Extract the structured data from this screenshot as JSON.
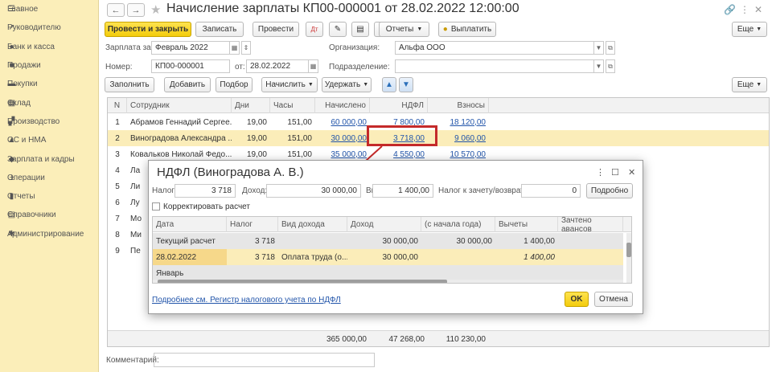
{
  "sidebar": {
    "items": [
      {
        "icon": "menu-icon",
        "label": "Главное"
      },
      {
        "icon": "trend-icon",
        "label": "Руководителю"
      },
      {
        "icon": "bank-icon",
        "label": "Банк и касса"
      },
      {
        "icon": "cart-icon",
        "label": "Продажи"
      },
      {
        "icon": "basket-icon",
        "label": "Покупки"
      },
      {
        "icon": "warehouse-icon",
        "label": "Склад"
      },
      {
        "icon": "factory-icon",
        "label": "Производство"
      },
      {
        "icon": "assets-icon",
        "label": "ОС и НМА"
      },
      {
        "icon": "people-icon",
        "label": "Зарплата и кадры"
      },
      {
        "icon": "operations-icon",
        "label": "Операции"
      },
      {
        "icon": "reports-icon",
        "label": "Отчеты"
      },
      {
        "icon": "book-icon",
        "label": "Справочники"
      },
      {
        "icon": "gear-icon",
        "label": "Администрирование"
      }
    ]
  },
  "header": {
    "title": "Начисление зарплаты КП00-000001 от 28.02.2022 12:00:00",
    "back": "←",
    "forward": "→",
    "star": "★"
  },
  "toolbar": {
    "post_close": "Провести и закрыть",
    "save": "Записать",
    "post": "Провести",
    "reports": "Отчеты",
    "pay": "Выплатить",
    "more": "Еще"
  },
  "form": {
    "salary_for_label": "Зарплата за:",
    "salary_for_value": "Февраль 2022",
    "org_label": "Организация:",
    "org_value": "Альфа ООО",
    "number_label": "Номер:",
    "number_value": "КП00-000001",
    "date_label": "от:",
    "date_value": "28.02.2022",
    "dept_label": "Подразделение:",
    "dept_value": ""
  },
  "table_toolbar": {
    "fill": "Заполнить",
    "add": "Добавить",
    "select": "Подбор",
    "accrue": "Начислить",
    "withhold": "Удержать",
    "more": "Еще"
  },
  "table": {
    "columns": [
      "N",
      "Сотрудник",
      "Дни",
      "Часы",
      "Начислено",
      "НДФЛ",
      "Взносы"
    ],
    "rows": [
      {
        "n": "1",
        "emp": "Абрамов Геннадий Сергее...",
        "days": "19,00",
        "hours": "151,00",
        "accrued": "60 000,00",
        "ndfl": "7 800,00",
        "contrib": "18 120,00"
      },
      {
        "n": "2",
        "emp": "Виноградова Александра ...",
        "days": "19,00",
        "hours": "151,00",
        "accrued": "30 000,00",
        "ndfl": "3 718,00",
        "contrib": "9 060,00"
      },
      {
        "n": "3",
        "emp": "Ковальков Николай Федо...",
        "days": "19,00",
        "hours": "151,00",
        "accrued": "35 000,00",
        "ndfl": "4 550,00",
        "contrib": "10 570,00"
      },
      {
        "n": "4",
        "emp": "Ла",
        "days": "",
        "hours": "",
        "accrued": "",
        "ndfl": "",
        "contrib": ""
      },
      {
        "n": "5",
        "emp": "Ли",
        "days": "",
        "hours": "",
        "accrued": "",
        "ndfl": "",
        "contrib": ""
      },
      {
        "n": "6",
        "emp": "Лу",
        "days": "",
        "hours": "",
        "accrued": "",
        "ndfl": "",
        "contrib": ""
      },
      {
        "n": "7",
        "emp": "Мо",
        "days": "",
        "hours": "",
        "accrued": "",
        "ndfl": "",
        "contrib": ""
      },
      {
        "n": "8",
        "emp": "Ми",
        "days": "",
        "hours": "",
        "accrued": "",
        "ndfl": "",
        "contrib": ""
      },
      {
        "n": "9",
        "emp": "Пе",
        "days": "",
        "hours": "",
        "accrued": "",
        "ndfl": "",
        "contrib": ""
      }
    ],
    "totals": {
      "accrued": "365 000,00",
      "ndfl": "47 268,00",
      "contrib": "110 230,00"
    }
  },
  "comment_label": "Комментарий:",
  "modal": {
    "title": "НДФЛ (Виноградова А. В.)",
    "tax_label": "Налог:",
    "tax_value": "3 718",
    "income_label": "Доход:",
    "income_value": "30 000,00",
    "deductions_label": "Вычеты:",
    "deductions_value": "1 400,00",
    "offset_label": "Налог к зачету/возврату:",
    "offset_value": "0",
    "details_btn": "Подробно",
    "correct_label": "Корректировать расчет",
    "columns": [
      "Дата",
      "Налог",
      "Вид дохода",
      "Доход",
      "(с начала года)",
      "Вычеты",
      "Зачтено авансов"
    ],
    "rows": [
      {
        "date": "Текущий расчет",
        "tax": "3 718",
        "kind": "",
        "income": "30 000,00",
        "ytd": "30 000,00",
        "ded": "1 400,00",
        "adv": ""
      },
      {
        "date": "28.02.2022",
        "tax": "3 718",
        "kind": "Оплата труда (о...",
        "income": "30 000,00",
        "ytd": "",
        "ded": "1 400,00",
        "adv": ""
      },
      {
        "date": "Январь",
        "tax": "",
        "kind": "",
        "income": "",
        "ytd": "",
        "ded": "",
        "adv": ""
      }
    ],
    "link": "Подробнее см. Регистр налогового учета по НДФЛ",
    "ok": "OK",
    "cancel": "Отмена"
  }
}
